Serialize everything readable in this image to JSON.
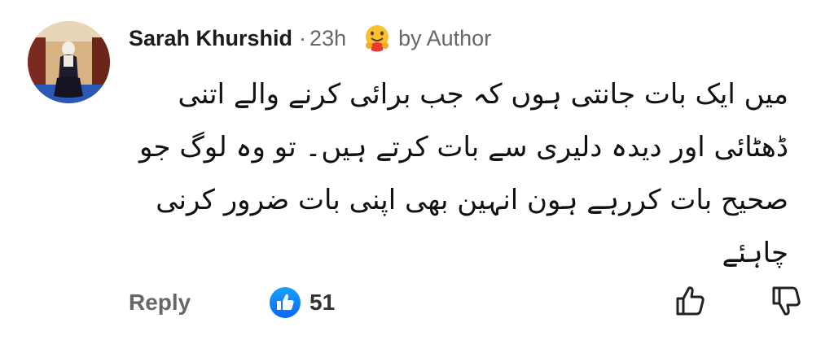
{
  "comment": {
    "author": "Sarah Khurshid",
    "separator": "·",
    "time": "23h",
    "badge_icon": "hugging-face-emoji",
    "badge_label": "by Author",
    "lines": [
      "میں ایک بات جانتی ہوں کہ جب برائی کرنے والے اتنی",
      "ڈھٹائی اور دیدہ دلیری سے بات کرتے ہیں۔ تو وہ لوگ جو",
      "صحیح بات کررہے ہون انہین بھی اپنی بات ضرور کرنی",
      "چاہئے"
    ]
  },
  "actions": {
    "reply_label": "Reply",
    "like_icon": "thumbs-up-badge",
    "like_count": "51",
    "upvote_icon": "thumb-up-outline",
    "downvote_icon": "thumb-down-outline"
  },
  "colors": {
    "secondary_text": "#65676b",
    "like_blue": "#1877f2",
    "emoji_yellow": "#fbc02d"
  }
}
